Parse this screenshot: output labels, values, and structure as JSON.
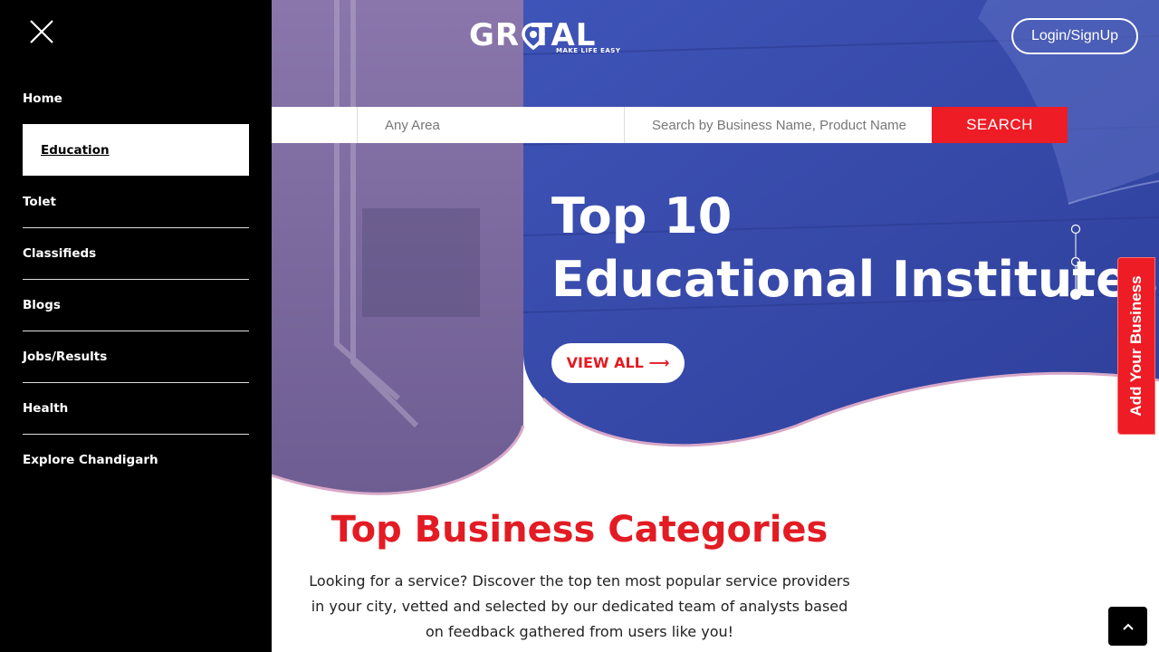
{
  "brand": {
    "name": "GR TAL",
    "tagline": "MAKE LIFE EASY"
  },
  "header": {
    "login_label": "Login/SignUp"
  },
  "search": {
    "area_placeholder": "Any Area",
    "query_placeholder": "Search by Business Name, Product Name",
    "button_label": "SEARCH"
  },
  "hero": {
    "line1": "Top 10",
    "line2": "Educational Institutes",
    "cta_label": "VIEW ALL ⟶"
  },
  "side_tab": {
    "label": "Add Your Business"
  },
  "section": {
    "title": "Top Business Categories",
    "description": "Looking for a service? Discover the top ten most popular service providers in your city, vetted and selected by our dedicated team of analysts based on feedback gathered from users like you!"
  },
  "menu": {
    "items": [
      {
        "label": "Home"
      },
      {
        "label": "Education",
        "active": true
      },
      {
        "label": "Tolet"
      },
      {
        "label": "Classifieds"
      },
      {
        "label": "Blogs"
      },
      {
        "label": "Jobs/Results"
      },
      {
        "label": "Health"
      },
      {
        "label": "Explore Chandigarh"
      }
    ]
  },
  "icons": [
    "close-icon",
    "location-pin-icon",
    "arrow-right-icon",
    "chevron-up-icon"
  ],
  "colors": {
    "accent": "#ee1c25",
    "hero_blue": "#3547a6",
    "hero_purple": "#7d6aa0",
    "menu_bg": "#000000"
  }
}
